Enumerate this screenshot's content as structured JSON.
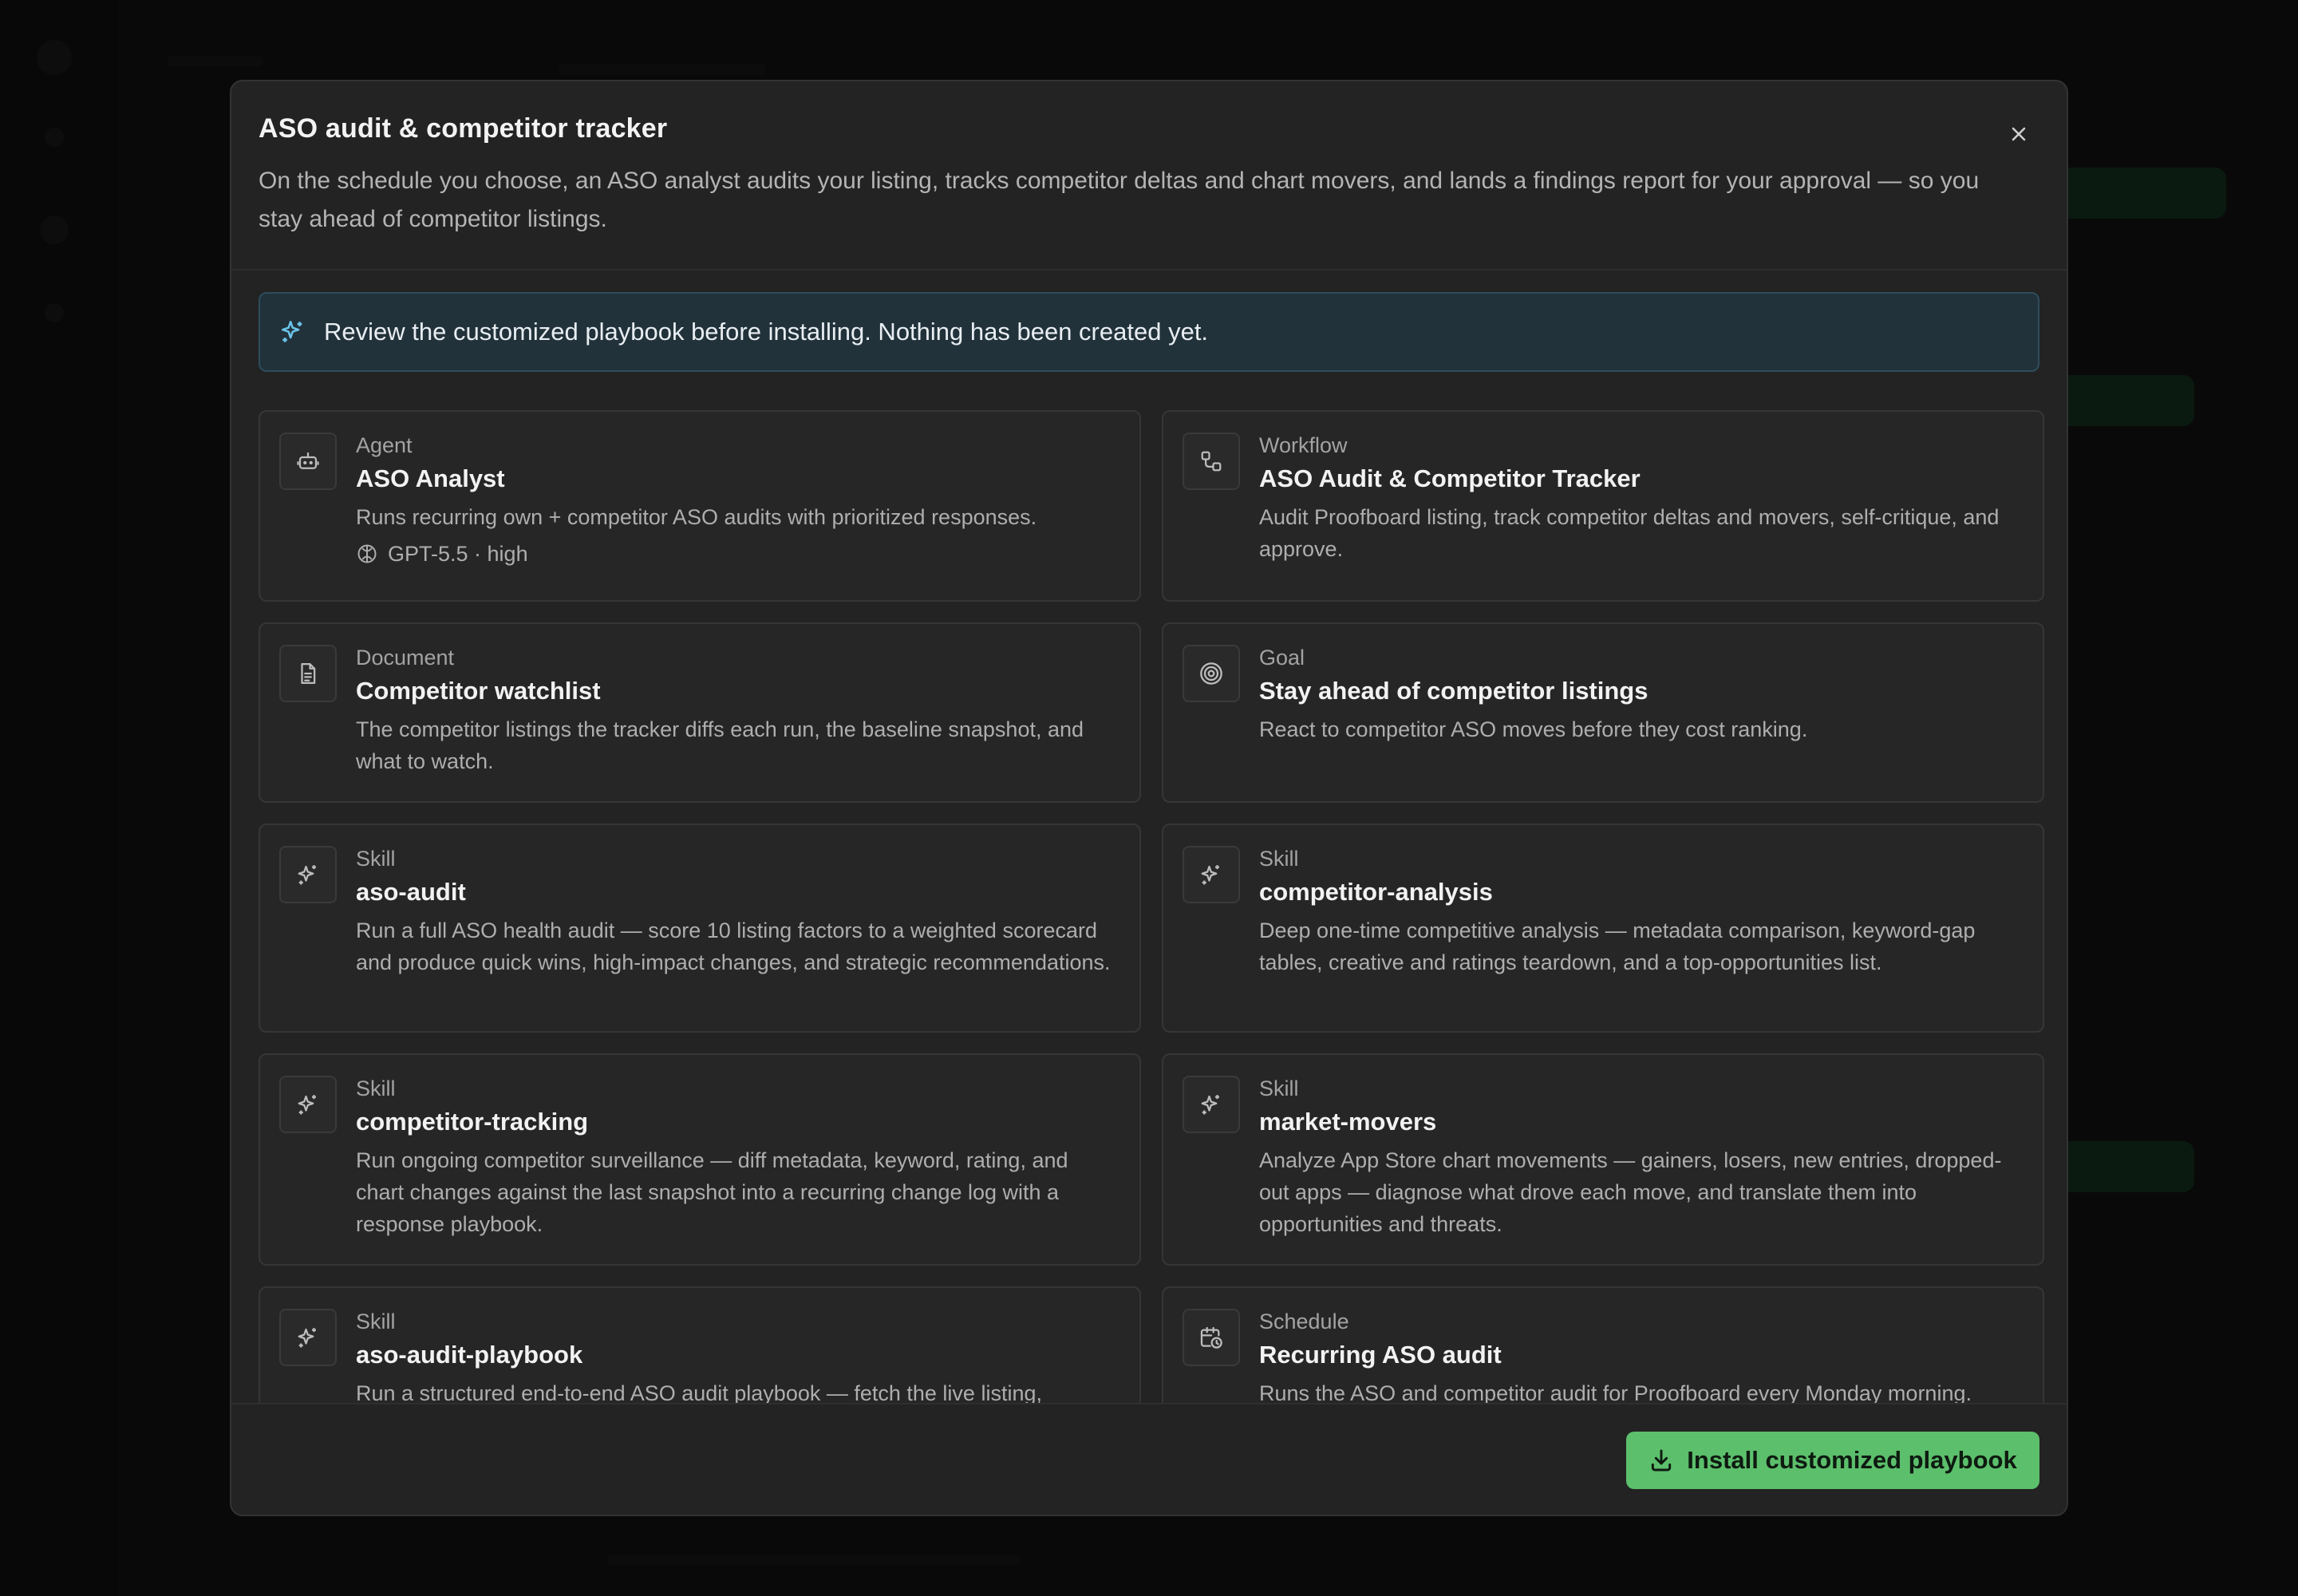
{
  "modal": {
    "title": "ASO audit & competitor tracker",
    "description": "On the schedule you choose, an ASO analyst audits your listing, tracks competitor deltas and chart movers, and lands a findings report for your approval — so you stay ahead of competitor listings.",
    "close_icon": "close-icon"
  },
  "notice": {
    "icon": "sparkle-icon",
    "text": "Review the customized playbook before installing. Nothing has been created yet.",
    "accent": "#6cc4ea"
  },
  "cards": [
    {
      "icon": "robot-icon",
      "type": "Agent",
      "title": "ASO Analyst",
      "description": "Runs recurring own + competitor ASO audits with prioritized responses.",
      "meta": "GPT-5.5 · high"
    },
    {
      "icon": "workflow-icon",
      "type": "Workflow",
      "title": "ASO Audit & Competitor Tracker",
      "description": "Audit Proofboard listing, track competitor deltas and movers, self-critique, and approve."
    },
    {
      "icon": "document-icon",
      "type": "Document",
      "title": "Competitor watchlist",
      "description": "The competitor listings the tracker diffs each run, the baseline snapshot, and what to watch."
    },
    {
      "icon": "target-icon",
      "type": "Goal",
      "title": "Stay ahead of competitor listings",
      "description": "React to competitor ASO moves before they cost ranking."
    },
    {
      "icon": "sparkle-icon",
      "type": "Skill",
      "title": "aso-audit",
      "description": "Run a full ASO health audit — score 10 listing factors to a weighted scorecard and produce quick wins, high-impact changes, and strategic recommendations."
    },
    {
      "icon": "sparkle-icon",
      "type": "Skill",
      "title": "competitor-analysis",
      "description": "Deep one-time competitive analysis — metadata comparison, keyword-gap tables, creative and ratings teardown, and a top-opportunities list."
    },
    {
      "icon": "sparkle-icon",
      "type": "Skill",
      "title": "competitor-tracking",
      "description": "Run ongoing competitor surveillance — diff metadata, keyword, rating, and chart changes against the last snapshot into a recurring change log with a response playbook."
    },
    {
      "icon": "sparkle-icon",
      "type": "Skill",
      "title": "market-movers",
      "description": "Analyze App Store chart movements — gainers, losers, new entries, dropped-out apps — diagnose what drove each move, and translate them into opportunities and threats."
    },
    {
      "icon": "sparkle-icon",
      "type": "Skill",
      "title": "aso-audit-playbook",
      "description": "Run a structured end-to-end ASO audit playbook — fetch the live listing,"
    },
    {
      "icon": "calendar-clock-icon",
      "type": "Schedule",
      "title": "Recurring ASO audit",
      "description": "Runs the ASO and competitor audit for Proofboard every Monday morning."
    }
  ],
  "footer": {
    "install_label": "Install customized playbook",
    "install_icon": "download-icon",
    "install_color": "#5cbf6c"
  }
}
